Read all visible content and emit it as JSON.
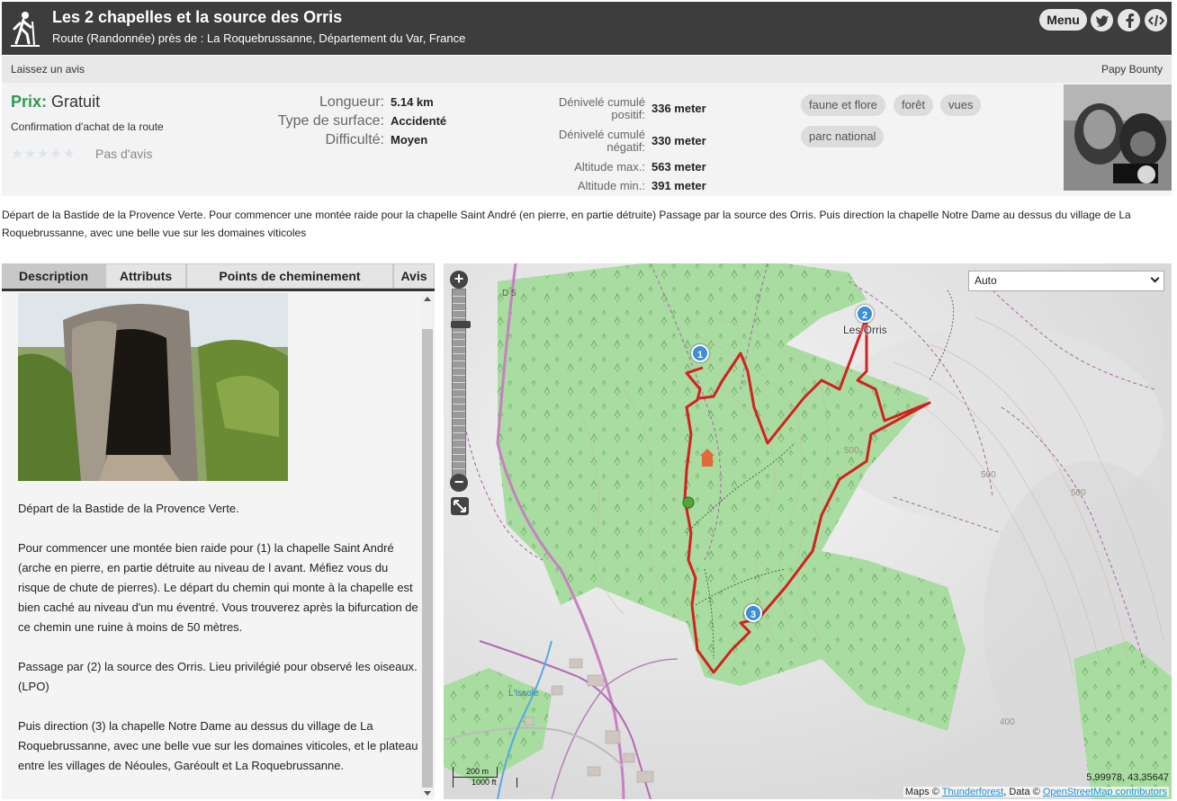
{
  "header": {
    "title": "Les 2 chapelles et la source des Orris",
    "subtitle": "Route (Randonnée) près de : La Roquebrussanne, Département du Var, France",
    "menu_label": "Menu",
    "icons": [
      "hiker-icon",
      "twitter-icon",
      "facebook-icon",
      "embed-code-icon"
    ]
  },
  "review_bar": {
    "leave_review": "Laissez un avis",
    "author": "Papy Bounty"
  },
  "info": {
    "price_label": "Prix:",
    "price_value": "Gratuit",
    "purchase_confirmation": "Confirmation d'achat de la route",
    "rating_text": "Pas d'avis",
    "stats_left": [
      {
        "label": "Longueur:",
        "value": "5.14 km"
      },
      {
        "label": "Type de surface:",
        "value": "Accidenté"
      },
      {
        "label": "Difficulté:",
        "value": "Moyen"
      }
    ],
    "stats_right": [
      {
        "label_line1": "Dénivelé cumulé",
        "label_line2": "positif:",
        "value": "336 meter"
      },
      {
        "label_line1": "Dénivelé cumulé",
        "label_line2": "négatif:",
        "value": "330 meter"
      },
      {
        "label": "Altitude max.:",
        "value": "563 meter"
      },
      {
        "label": "Altitude min.:",
        "value": "391 meter"
      }
    ],
    "tags": [
      "faune et flore",
      "forêt",
      "vues",
      "parc national"
    ]
  },
  "summary": "Départ de la Bastide de la Provence Verte. Pour commencer une montée raide pour la chapelle Saint André (en pierre, en partie détruite) Passage par la source des Orris. Puis direction la chapelle Notre Dame au dessus du village de La Roquebrussanne, avec une belle vue sur les domaines viticoles",
  "tabs": [
    "Description",
    "Attributs",
    "Points de cheminement",
    "Avis"
  ],
  "description": {
    "paragraphs": [
      "Départ de la Bastide de la Provence Verte.",
      "Pour commencer une montée bien raide pour (1) la chapelle Saint André (arche en pierre, en partie détruite au niveau de l avant. Méfiez vous du risque de chute de pierres). Le départ du chemin qui monte à la chapelle est bien caché au niveau d'un mu éventré. Vous trouverez après la bifurcation de ce chemin une ruine à moins de 50 mètres.",
      "Passage par (2) la source des Orris. Lieu privilégié pour observé les oiseaux. (LPO)",
      "Puis direction (3) la chapelle Notre Dame au dessus du village de La Roquebrussanne, avec une belle vue sur les domaines viticoles, et le plateau entre les villages de Néoules, Garéoult et La Roquebrussanne."
    ]
  },
  "map": {
    "layer_select": "Auto",
    "zoom_in": "+",
    "zoom_out": "−",
    "markers": [
      "1",
      "2",
      "3"
    ],
    "place_label": "Les Orris",
    "road_label": "D 5",
    "river_label": "L'Issole",
    "contours": [
      "500",
      "500",
      "500",
      "400"
    ],
    "scale_m": "200 m",
    "scale_ft": "1000 ft",
    "coordinates": "5.99978, 43.35647",
    "attribution_prefix": "Maps ©",
    "attribution_thunderforest": "Thunderforest",
    "attribution_middle": ", Data ©",
    "attribution_osm": "OpenStreetMap contributors",
    "route_color": "#d42020",
    "forest_color": "#a8dca0"
  }
}
